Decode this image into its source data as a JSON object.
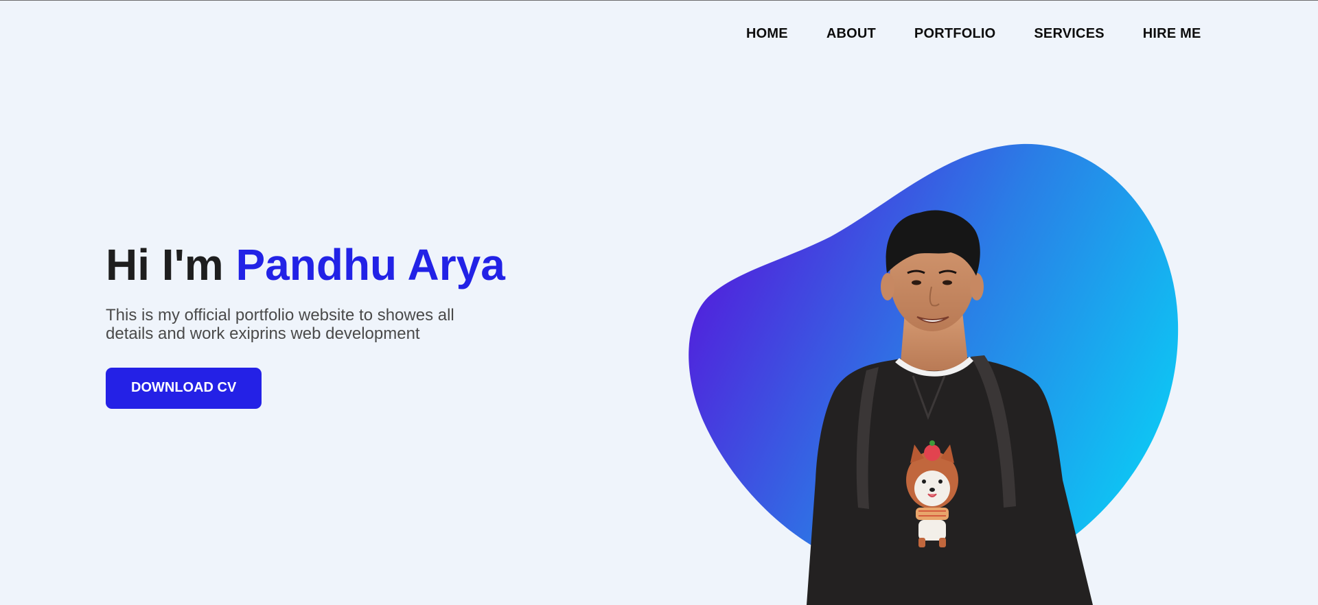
{
  "nav": {
    "items": [
      {
        "label": "HOME"
      },
      {
        "label": "ABOUT"
      },
      {
        "label": "PORTFOLIO"
      },
      {
        "label": "SERVICES"
      },
      {
        "label": "HIRE ME"
      }
    ]
  },
  "hero": {
    "greeting": "Hi I'm ",
    "name": "Pandhu Arya",
    "description": "This is my official portfolio website to showes all details and work exiprins web development",
    "cta_label": "DOWNLOAD CV"
  },
  "colors": {
    "accent": "#2421e6",
    "background": "#eff4fb",
    "blob_gradient_start": "#5121dc",
    "blob_gradient_end": "#0ccaf5",
    "text_dark": "#1e1e1e"
  },
  "icons": {
    "portrait": "person-photo"
  }
}
